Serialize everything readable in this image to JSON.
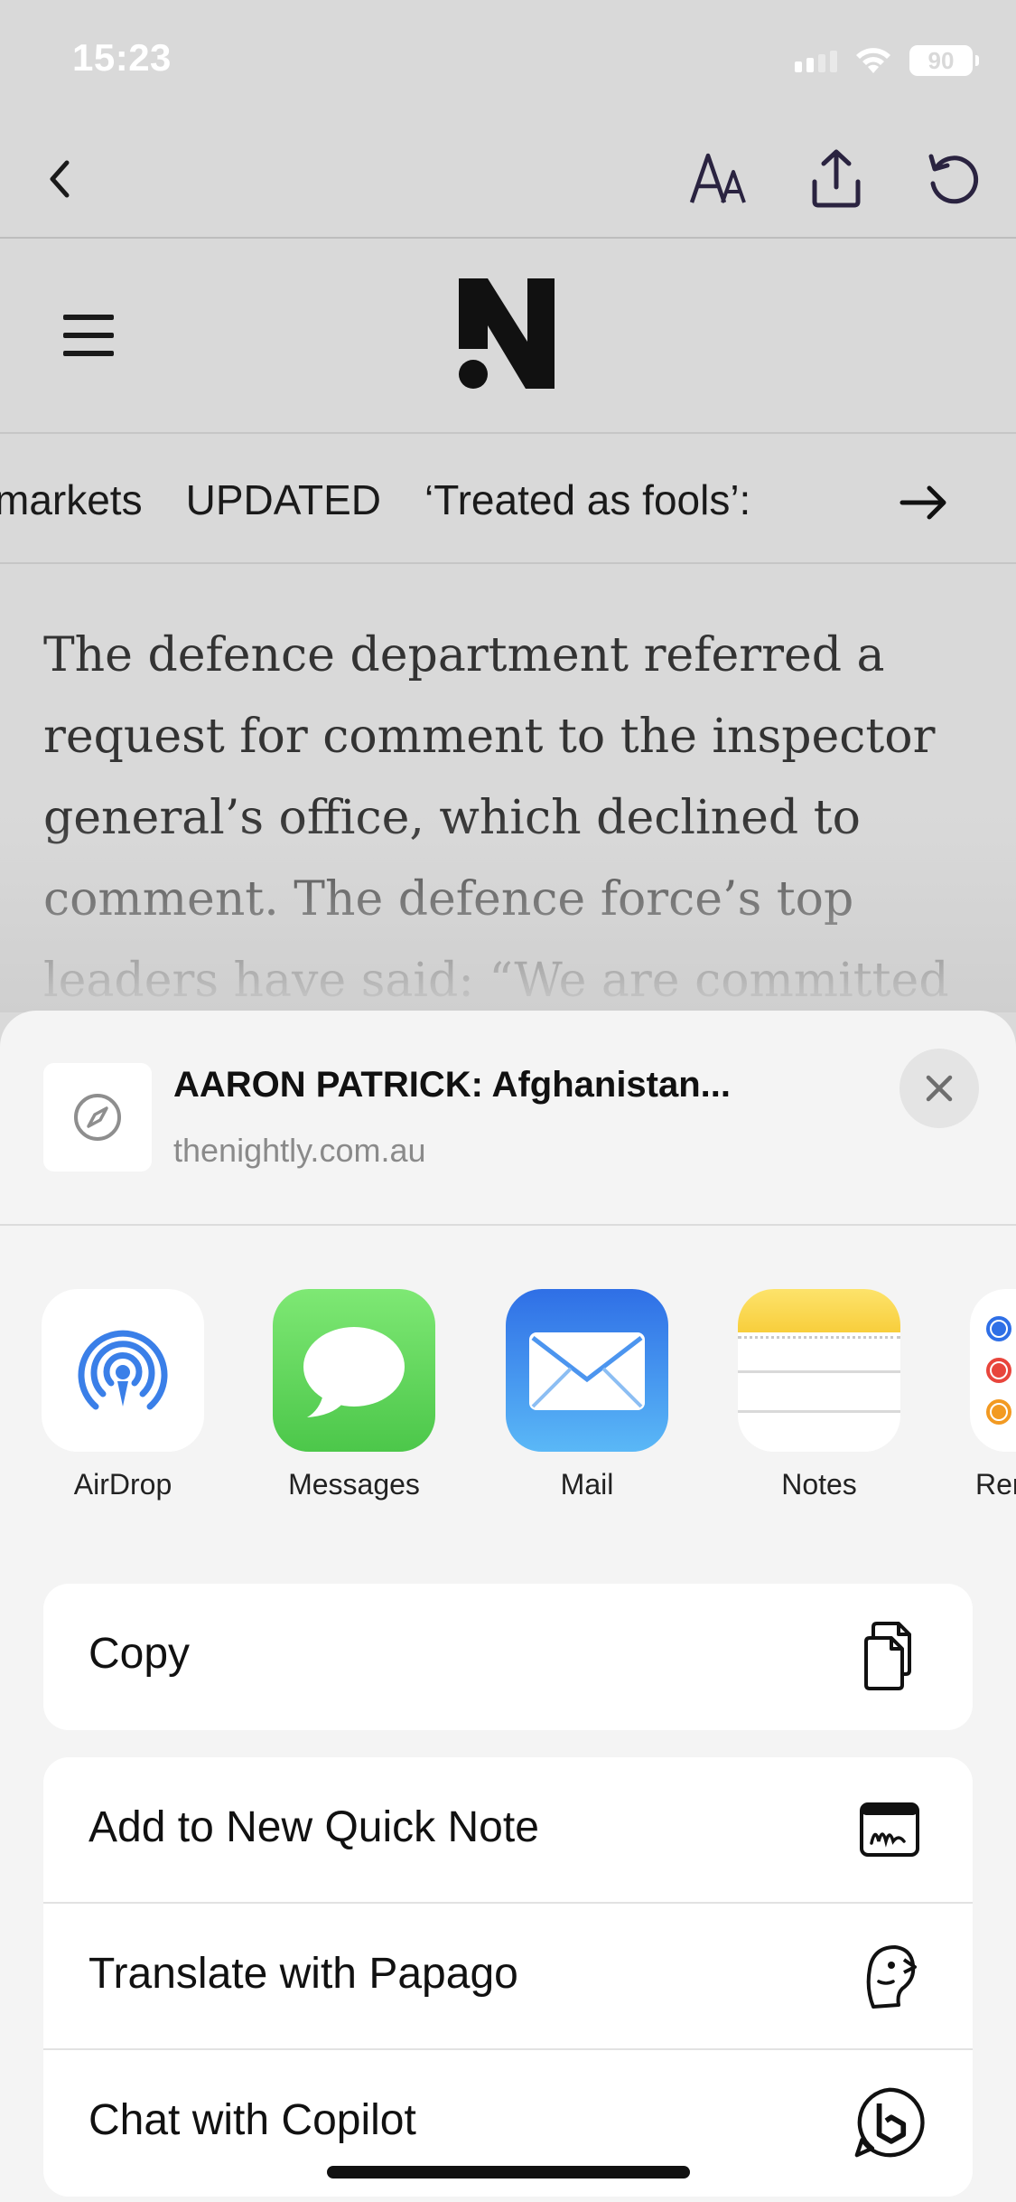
{
  "status_bar": {
    "time": "15:23",
    "battery": "90"
  },
  "toolbar": {
    "back_icon": "chevron-left-icon",
    "text_size_icon": "text-size-icon",
    "share_icon": "share-icon",
    "reload_icon": "reload-icon"
  },
  "site": {
    "menu_icon": "hamburger-menu-icon",
    "logo": "N"
  },
  "ticker": {
    "items": [
      "markets",
      "UPDATED",
      "‘Treated as fools’:"
    ],
    "arrow_icon": "arrow-right-icon"
  },
  "article": {
    "paragraph": "The defence department referred a request for comment to the inspector general’s office, which declined to comment. The defence force’s top leaders have said: “We are committed"
  },
  "share_sheet": {
    "title": "AARON PATRICK: Afghanistan...",
    "url": "thenightly.com.au",
    "close_icon": "close-icon",
    "thumb_icon": "compass-icon",
    "apps": [
      {
        "label": "AirDrop",
        "icon": "airdrop-icon"
      },
      {
        "label": "Messages",
        "icon": "messages-icon"
      },
      {
        "label": "Mail",
        "icon": "mail-icon"
      },
      {
        "label": "Notes",
        "icon": "notes-icon"
      },
      {
        "label": "Rem",
        "icon": "reminders-icon"
      }
    ],
    "copy": {
      "label": "Copy",
      "icon": "copy-icon"
    },
    "actions": [
      {
        "label": "Add to New Quick Note",
        "icon": "quick-note-icon"
      },
      {
        "label": "Translate with Papago",
        "icon": "papago-icon"
      },
      {
        "label": "Chat with Copilot",
        "icon": "copilot-icon"
      }
    ]
  },
  "colors": {
    "dimmed_background": "#d9d9d9",
    "sheet_background": "#f4f4f4",
    "messages_green": "#5fd65c",
    "mail_blue": "#3a8ff5",
    "notes_yellow": "#fbd54b",
    "airdrop_blue": "#3a7fe8"
  }
}
